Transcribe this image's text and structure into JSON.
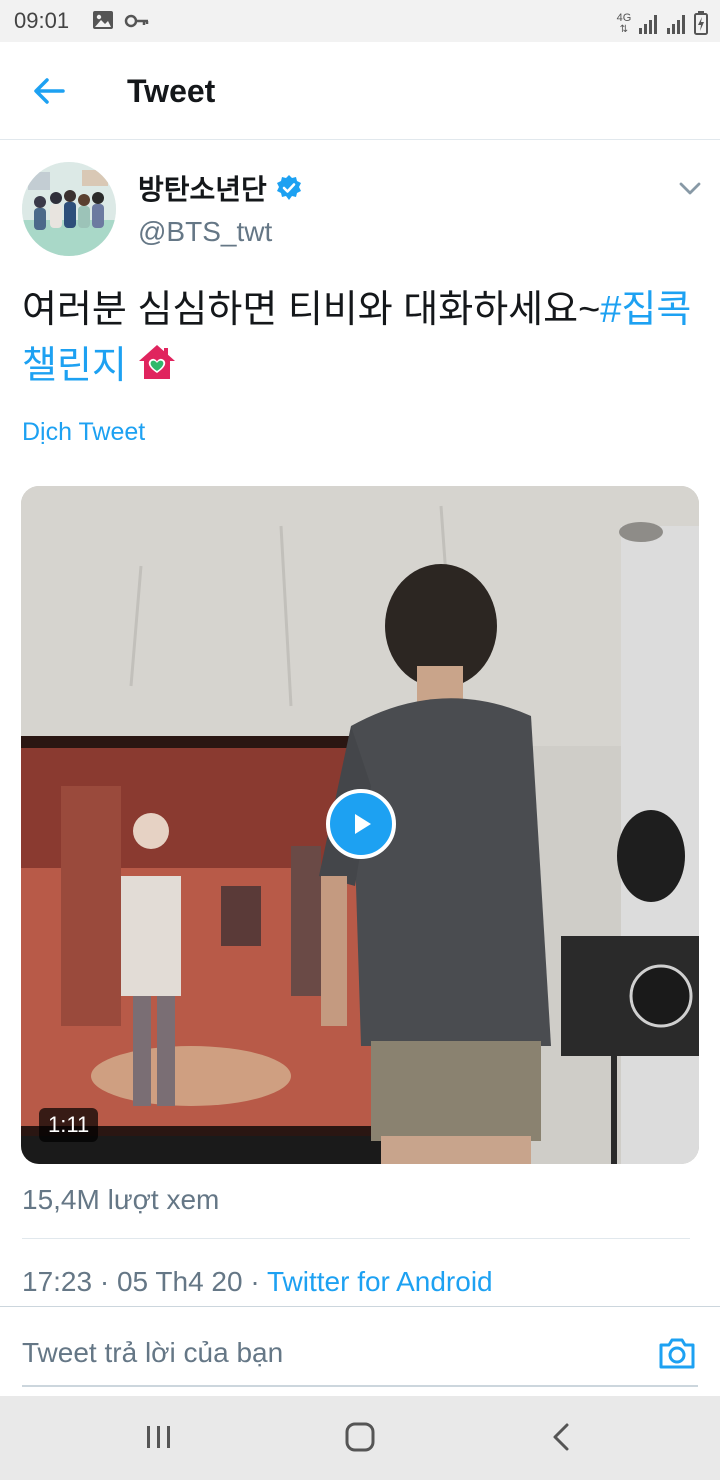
{
  "status_bar": {
    "time": "09:01",
    "icons": [
      "gallery-icon",
      "key-icon",
      "network-4g-icon",
      "signal-icon",
      "signal-icon",
      "battery-charging-icon"
    ],
    "network_label": "4G"
  },
  "header": {
    "back_icon": "arrow-left-icon",
    "title": "Tweet"
  },
  "tweet": {
    "author_name": "방탄소년단",
    "author_handle": "@BTS_twt",
    "verified": true,
    "text": "여러분 심심하면 티비와 대화하세요~",
    "hashtag": "#집콕챌린지",
    "emoji": "house-with-heart-icon",
    "translate_label": "Dịch Tweet",
    "video": {
      "duration": "1:11",
      "play_icon": "play-icon"
    },
    "views": "15,4M lượt xem",
    "time": "17:23",
    "date": "05 Th4 20",
    "separator": "·",
    "source": "Twitter for Android"
  },
  "reply": {
    "placeholder": "Tweet trả lời của bạn",
    "camera_icon": "camera-icon"
  },
  "nav": {
    "icons": [
      "recent-apps-icon",
      "home-icon",
      "back-icon"
    ]
  },
  "colors": {
    "accent": "#1da1f2",
    "text_primary": "#14171a",
    "text_secondary": "#657786"
  }
}
